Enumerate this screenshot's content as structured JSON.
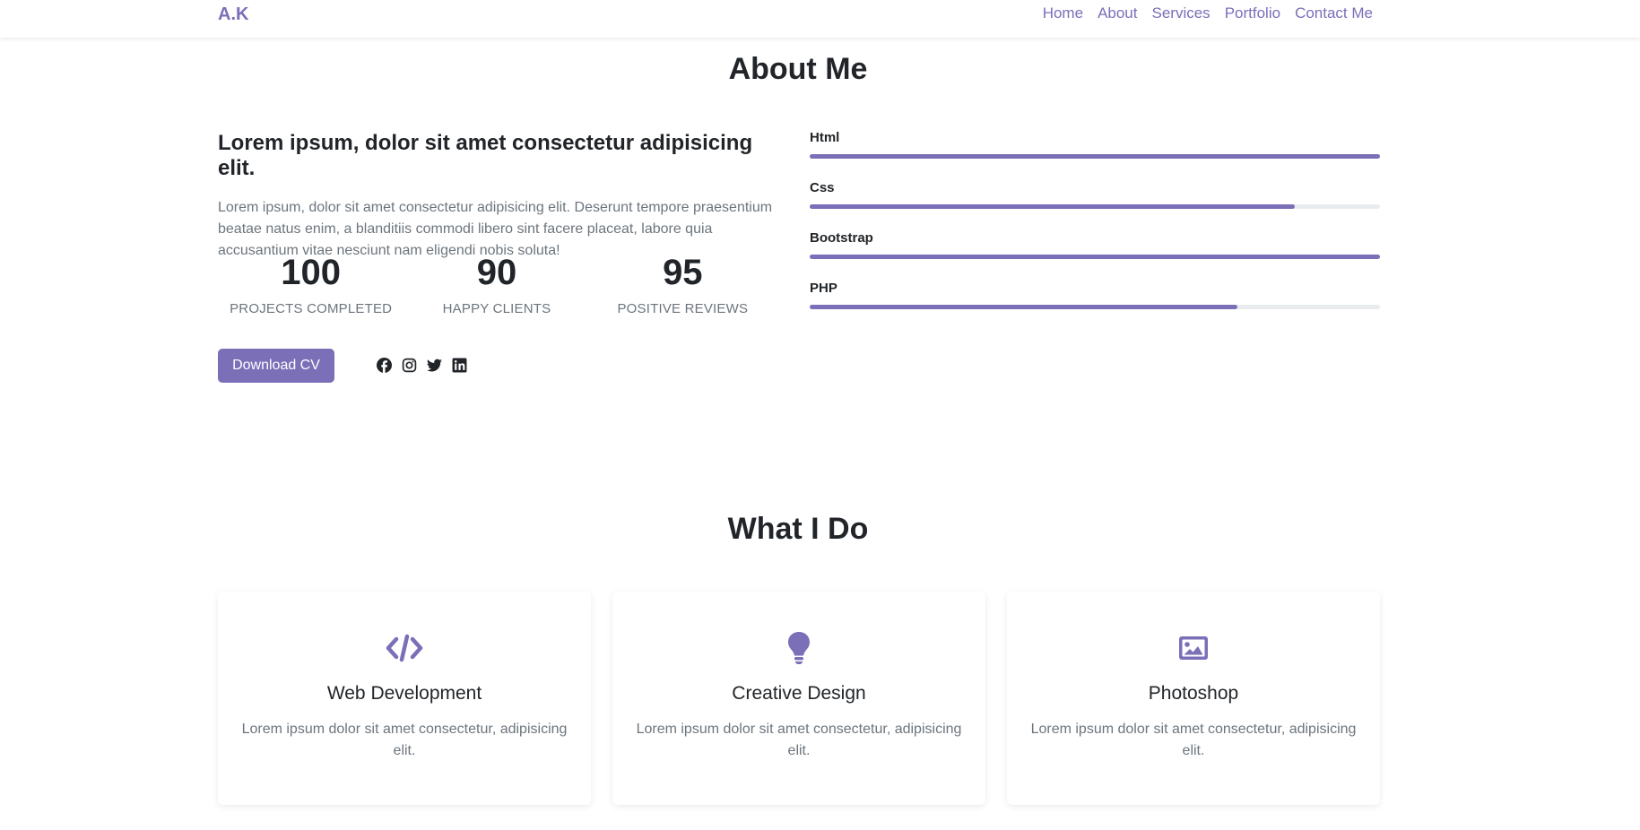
{
  "brand": "A.K",
  "nav": [
    "Home",
    "About",
    "Services",
    "Portfolio",
    "Contact Me"
  ],
  "about": {
    "title": "About Me",
    "heading": "Lorem ipsum, dolor sit amet consectetur adipisicing elit.",
    "text": "Lorem ipsum, dolor sit amet consectetur adipisicing elit. Deserunt tempore praesentium beatae natus enim, a blanditiis commodi libero sint facere placeat, labore quia accusantium vitae nesciunt nam eligendi nobis soluta!",
    "stats": [
      {
        "value": "100",
        "label": "PROJECTS COMPLETED"
      },
      {
        "value": "90",
        "label": "HAPPY CLIENTS"
      },
      {
        "value": "95",
        "label": "POSITIVE REVIEWS"
      }
    ],
    "cv_button": "Download CV",
    "socials": [
      "facebook-icon",
      "instagram-icon",
      "twitter-icon",
      "linkedin-icon"
    ],
    "skills": [
      {
        "label": "Html",
        "percent": 100
      },
      {
        "label": "Css",
        "percent": 85
      },
      {
        "label": "Bootstrap",
        "percent": 100
      },
      {
        "label": "PHP",
        "percent": 75
      }
    ]
  },
  "services": {
    "title": "What I Do",
    "cards": [
      {
        "icon": "code-icon",
        "title": "Web Development",
        "text": "Lorem ipsum dolor sit amet consectetur, adipisicing elit."
      },
      {
        "icon": "lightbulb-icon",
        "title": "Creative Design",
        "text": "Lorem ipsum dolor sit amet consectetur, adipisicing elit."
      },
      {
        "icon": "image-icon",
        "title": "Photoshop",
        "text": "Lorem ipsum dolor sit amet consectetur, adipisicing elit."
      }
    ]
  },
  "colors": {
    "accent": "#7b6fb8",
    "muted": "#6c757d",
    "track": "#e9ecef"
  }
}
